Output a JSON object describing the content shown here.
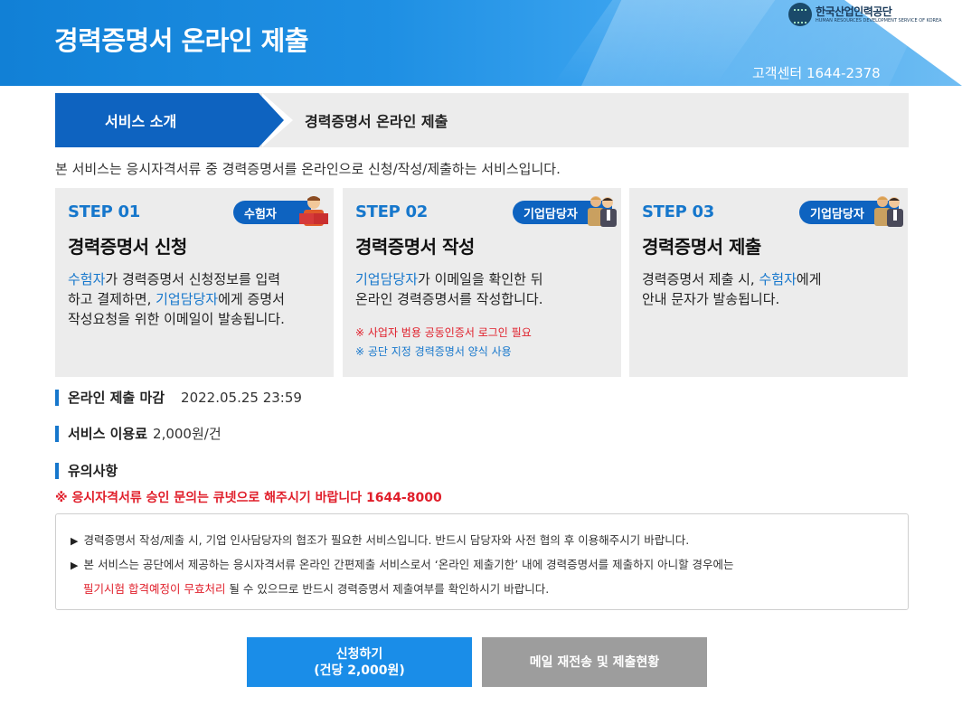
{
  "header": {
    "title": "경력증명서 온라인 제출",
    "phone": "고객센터 1644-2378",
    "logo_name": "한국산업인력공단",
    "logo_en": "HUMAN RESOURCES DEVELOPMENT SERVICE OF KOREA"
  },
  "tabs": {
    "active": "서비스 소개",
    "current": "경력증명서 온라인 제출"
  },
  "intro": "본 서비스는 응시자격서류 중 경력증명서를 온라인으로 신청/작성/제출하는 서비스입니다.",
  "steps": [
    {
      "step": "STEP 01",
      "role": "수험자",
      "title": "경력증명서 신청",
      "d1_hl": "수험자",
      "d1": "가 경력증명서 신청정보를 입력",
      "d2a": "하고 결제하면, ",
      "d2_hl": "기업담당자",
      "d2b": "에게 증명서",
      "d3": "작성요청을 위한 이메일이 발송됩니다."
    },
    {
      "step": "STEP 02",
      "role": "기업담당자",
      "title": "경력증명서 작성",
      "d1_hl": "기업담당자",
      "d1": "가 이메일을 확인한 뒤",
      "d2": "온라인 경력증명서를 작성합니다.",
      "note1": "※ 사업자 범용 공동인증서 로그인 필요",
      "note2": "※ 공단 지정 경력증명서 양식 사용"
    },
    {
      "step": "STEP 03",
      "role": "기업담당자",
      "title": "경력증명서 제출",
      "d1a": "경력증명서 제출 시, ",
      "d1_hl": "수험자",
      "d1b": "에게",
      "d2": "안내 문자가 발송됩니다."
    }
  ],
  "deadline": {
    "label": "온라인 제출 마감",
    "value": "2022.05.25 23:59"
  },
  "fee": {
    "label": "서비스 이용료",
    "value": "2,000원/건"
  },
  "caution": {
    "label": "유의사항"
  },
  "warning": "※ 응시자격서류 승인 문의는 큐넷으로 해주시기 바랍니다 1644-8000",
  "notice": {
    "line1": "경력증명서 작성/제출 시, 기업 인사담당자의 협조가 필요한 서비스입니다. 반드시 담당자와 사전 협의 후 이용해주시기 바랍니다.",
    "line2": "본 서비스는 공단에서 제공하는 응시자격서류 온라인 간편제출 서비스로서 ‘온라인 제출기한’ 내에 경력증명서를 제출하지 아니할 경우에는",
    "line3_red": "필기시험 합격예정이 무효처리",
    "line3": " 될 수 있으므로 반드시 경력증명서 제출여부를 확인하시기 바랍니다."
  },
  "buttons": {
    "apply_line1": "신청하기",
    "apply_line2": "(건당 2,000원)",
    "resend": "메일 재전송 및 제출현황"
  },
  "colors": {
    "primary": "#0e63c0",
    "accent": "#1677cc",
    "warning": "#e01e2a",
    "button": "#1a8de8",
    "button_gray": "#9d9d9d"
  }
}
